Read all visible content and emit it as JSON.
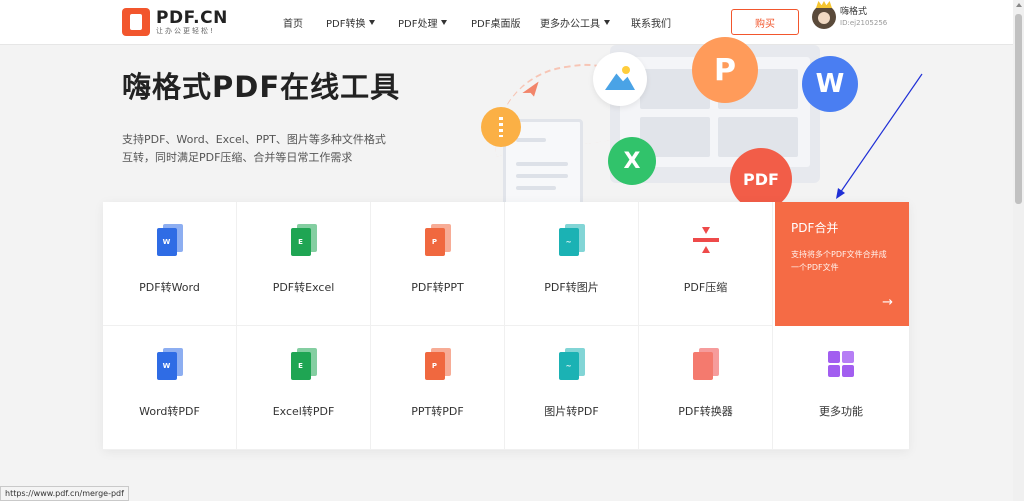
{
  "header": {
    "logo_name": "PDF.CN",
    "logo_slogan": "让办公更轻松!",
    "nav": [
      {
        "label": "首页",
        "dropdown": false
      },
      {
        "label": "PDF转换",
        "dropdown": true
      },
      {
        "label": "PDF处理",
        "dropdown": true
      },
      {
        "label": "PDF桌面版",
        "dropdown": false
      },
      {
        "label": "更多办公工具",
        "dropdown": true
      },
      {
        "label": "联系我们",
        "dropdown": false
      }
    ],
    "buy_label": "购买",
    "user_name": "嗨格式",
    "user_id": "ID:ej2105256"
  },
  "hero": {
    "title": "嗨格式PDF在线工具",
    "desc_line1": "支持PDF、Word、Excel、PPT、图片等多种文件格式",
    "desc_line2": "互转，同时满足PDF压缩、合并等日常工作需求",
    "illustration_letters": {
      "top": "P",
      "w": "W",
      "x": "X",
      "pdf": "PDF"
    }
  },
  "tools": {
    "row1": [
      {
        "label": "PDF转Word",
        "icon": "word-file-icon",
        "glyph": "W",
        "color": "#2f6ce5"
      },
      {
        "label": "PDF转Excel",
        "icon": "excel-file-icon",
        "glyph": "E",
        "color": "#1fa553"
      },
      {
        "label": "PDF转PPT",
        "icon": "ppt-file-icon",
        "glyph": "P",
        "color": "#f0683f"
      },
      {
        "label": "PDF转图片",
        "icon": "image-file-icon",
        "glyph": "~",
        "color": "#1bb2b4"
      },
      {
        "label": "PDF压缩",
        "icon": "compress-icon"
      }
    ],
    "merge": {
      "title": "PDF合并",
      "desc": "支持将多个PDF文件合并成一个PDF文件",
      "arrow": "→"
    },
    "row2": [
      {
        "label": "Word转PDF",
        "icon": "word-file-icon",
        "glyph": "W",
        "color": "#2f6ce5"
      },
      {
        "label": "Excel转PDF",
        "icon": "excel-file-icon",
        "glyph": "E",
        "color": "#1fa553"
      },
      {
        "label": "PPT转PDF",
        "icon": "ppt-file-icon",
        "glyph": "P",
        "color": "#f0683f"
      },
      {
        "label": "图片转PDF",
        "icon": "image-file-icon",
        "glyph": "~",
        "color": "#1bb2b4"
      },
      {
        "label": "PDF转换器",
        "icon": "converter-icon",
        "color": "#ef4b4b"
      },
      {
        "label": "更多功能",
        "icon": "grid-icon",
        "color": "#a25ef0"
      }
    ]
  },
  "status_url": "https://www.pdf.cn/merge-pdf"
}
